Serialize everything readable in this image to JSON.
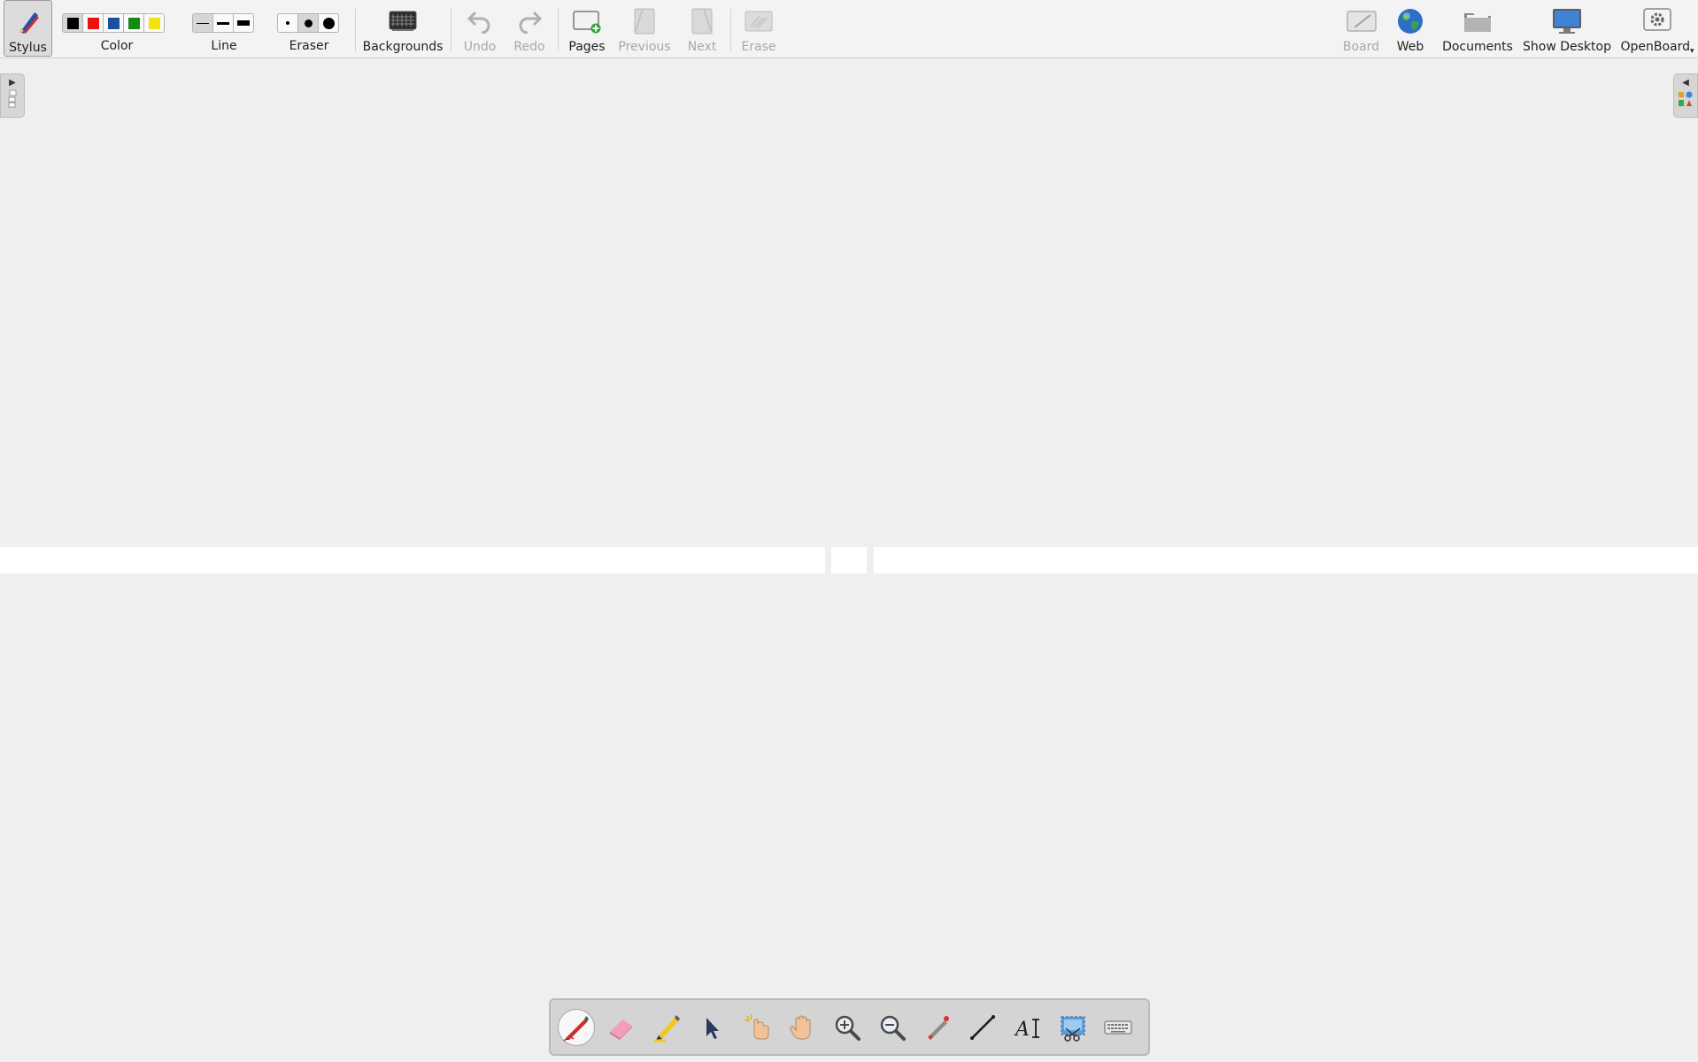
{
  "toolbar": {
    "stylus": "Stylus",
    "color": "Color",
    "line": "Line",
    "eraser": "Eraser",
    "backgrounds": "Backgrounds",
    "undo": "Undo",
    "redo": "Redo",
    "pages": "Pages",
    "previous": "Previous",
    "next": "Next",
    "erase": "Erase",
    "board": "Board",
    "web": "Web",
    "documents": "Documents",
    "show_desktop": "Show Desktop",
    "openboard": "OpenBoard"
  },
  "colors": [
    "#000000",
    "#ee1111",
    "#1c4fa0",
    "#138a13",
    "#f2e30c"
  ],
  "selected_color_index": 0,
  "line_widths": [
    "thin",
    "medium",
    "thick"
  ],
  "selected_line_index": 0,
  "eraser_sizes": [
    "small",
    "medium",
    "large"
  ],
  "selected_eraser_index": 1,
  "palette_tools": [
    "pen-icon",
    "eraser-icon",
    "highlighter-icon",
    "selector-icon",
    "interactor-icon",
    "hand-icon",
    "zoom-in-icon",
    "zoom-out-icon",
    "laser-pointer-icon",
    "line-icon",
    "text-icon",
    "capture-icon",
    "keyboard-icon"
  ],
  "selected_palette_tool": "pen-icon"
}
